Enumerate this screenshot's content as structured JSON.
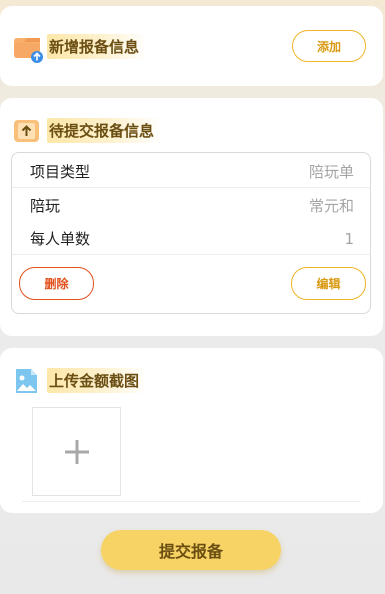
{
  "add_section": {
    "title": "新增报备信息",
    "add_button": "添加",
    "icon": "folder-upload-icon"
  },
  "pending_section": {
    "title": "待提交报备信息",
    "icon": "upload-arrow-icon",
    "rows": [
      {
        "label": "项目类型",
        "value": "陪玩单"
      },
      {
        "label": "陪玩",
        "value": "常元和"
      },
      {
        "label": "每人单数",
        "value": "1"
      }
    ],
    "delete_button": "删除",
    "edit_button": "编辑"
  },
  "upload_section": {
    "title": "上传金额截图",
    "icon": "image-icon",
    "add_image_icon": "plus-icon"
  },
  "submit_button": "提交报备",
  "colors": {
    "accent": "#f0b429",
    "delete": "#e2501c",
    "submit_bg": "#f7d365",
    "title": "#6b4e12"
  }
}
